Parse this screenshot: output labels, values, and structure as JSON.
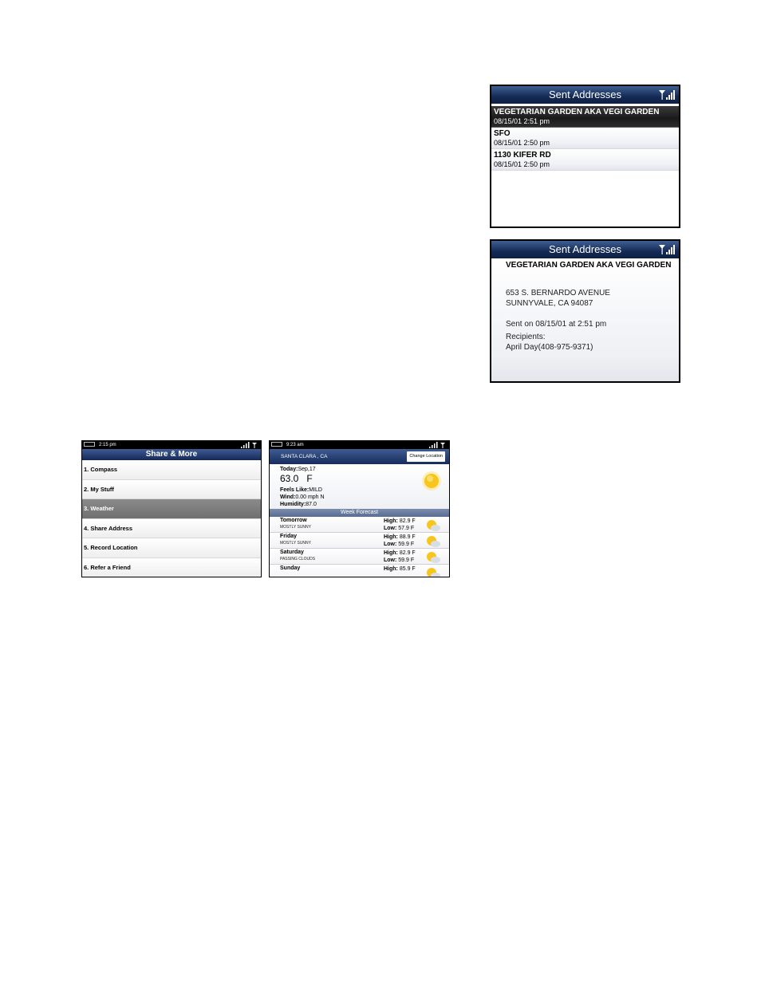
{
  "sent_list": {
    "title": "Sent Addresses",
    "items": [
      {
        "name": "VEGETARIAN GARDEN AKA VEGI GARDEN",
        "date": "08/15/01 2:51 pm"
      },
      {
        "name": "SFO",
        "date": "08/15/01 2:50 pm"
      },
      {
        "name": "1130 KIFER RD",
        "date": "08/15/01 2:50 pm"
      }
    ],
    "selected_index": 0
  },
  "sent_detail": {
    "title": "Sent Addresses",
    "name": "VEGETARIAN GARDEN AKA VEGI GARDEN",
    "address_line1": "653 S. BERNARDO AVENUE",
    "address_line2": "SUNNYVALE, CA 94087",
    "sent_on": "Sent on 08/15/01 at 2:51 pm",
    "recipients_label": "Recipients:",
    "recipient": "April Day(408-975-9371)"
  },
  "share_more": {
    "time": "2:15 pm",
    "title": "Share & More",
    "items": [
      "1. Compass",
      "2. My Stuff",
      "3. Weather",
      "4. Share Address",
      "5. Record Location",
      "6. Refer a Friend"
    ],
    "selected_index": 2
  },
  "weather": {
    "time": "9:23 am",
    "location": "SANTA CLARA , CA",
    "change_location": "Change Location",
    "today_label": "Today:",
    "today_date": "Sep,17",
    "temp": "63.0",
    "unit": "F",
    "feels_label": "Feels Like:",
    "feels_value": "MILD",
    "wind_label": "Wind:",
    "wind_value": "0.00 mph N",
    "humidity_label": "Humidity:",
    "humidity_value": "87.0",
    "week_forecast": "Week Forecast",
    "high_label": "High:",
    "low_label": "Low:",
    "days": [
      {
        "day": "Tomorrow",
        "cond": "MOSTLY SUNNY",
        "high": "82.9 F",
        "low": "57.9 F"
      },
      {
        "day": "Friday",
        "cond": "MOSTLY SUNNY",
        "high": "88.9 F",
        "low": "59.9 F"
      },
      {
        "day": "Saturday",
        "cond": "PASSING CLOUDS",
        "high": "82.9 F",
        "low": "59.9 F"
      },
      {
        "day": "Sunday",
        "cond": "",
        "high": "85.9 F",
        "low": ""
      }
    ]
  },
  "colors": {
    "title_bar": "#142a55",
    "selection_dark": "#1a1a1a",
    "selection_gray": "#7a7a7a",
    "week_bar": "#5a6d91"
  }
}
